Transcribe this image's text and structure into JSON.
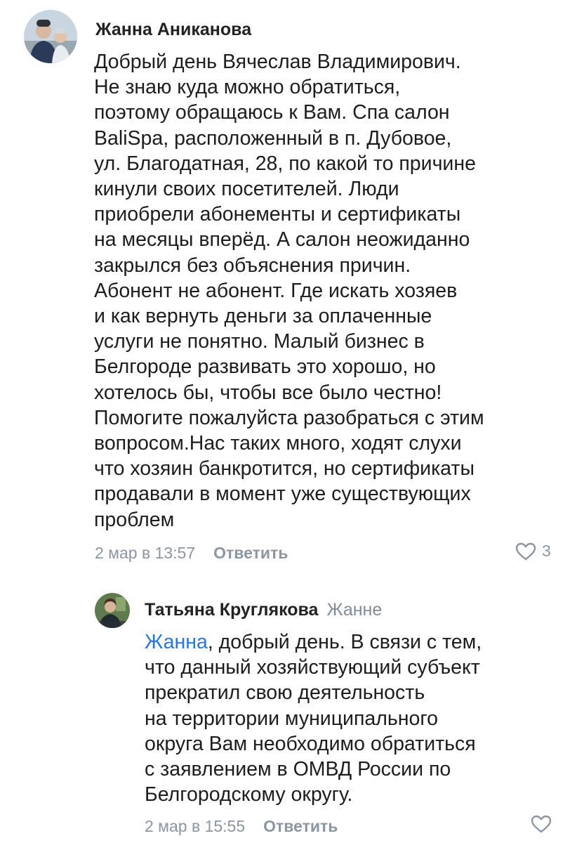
{
  "comments": [
    {
      "author": "Жанна Аниканова",
      "text": "Добрый день Вячеслав Владимирович.\nНе знаю куда можно обратиться,\nпоэтому обращаюсь к Вам. Спа салон\nBaliSpa, расположенный в п. Дубовое,\nул. Благодатная, 28, по какой то причине\nкинули своих посетителей. Люди\nприобрели абонементы и сертификаты\nна месяцы вперёд. А салон неожиданно\nзакрылся без объяснения причин.\nАбонент не абонент.  Где искать хозяев\nи как вернуть деньги за оплаченные\nуслуги не понятно. Малый бизнес  в\nБелгороде развивать это хорошо, но\nхотелось бы, чтобы все было честно!\nПомогите пожалуйста разобраться с этим\nвопросом.Нас таких много, ходят слухи\nчто хозяин банкротится, но сертификаты\nпродавали в момент уже существующих\nпроблем",
      "date": "2 мар в 13:57",
      "reply_label": "Ответить",
      "likes": "3"
    }
  ],
  "reply": {
    "author": "Татьяна Круглякова",
    "reply_to": "Жанне",
    "mention": "Жанна",
    "text": ", добрый день. В связи с тем,\nчто данный хозяйствующий субъект\nпрекратил свою деятельность\nна территории муниципального\nокруга Вам необходимо обратиться\nс заявлением в ОМВД России по\nБелгородскому округу.",
    "date": "2 мар в 15:55",
    "reply_label": "Ответить"
  },
  "colors": {
    "mention": "#2a78d8",
    "meta": "#8c96a2"
  },
  "icons": {
    "like": "heart-outline-icon",
    "avatar_1": "user-photo-avatar",
    "avatar_2": "user-photo-avatar"
  }
}
